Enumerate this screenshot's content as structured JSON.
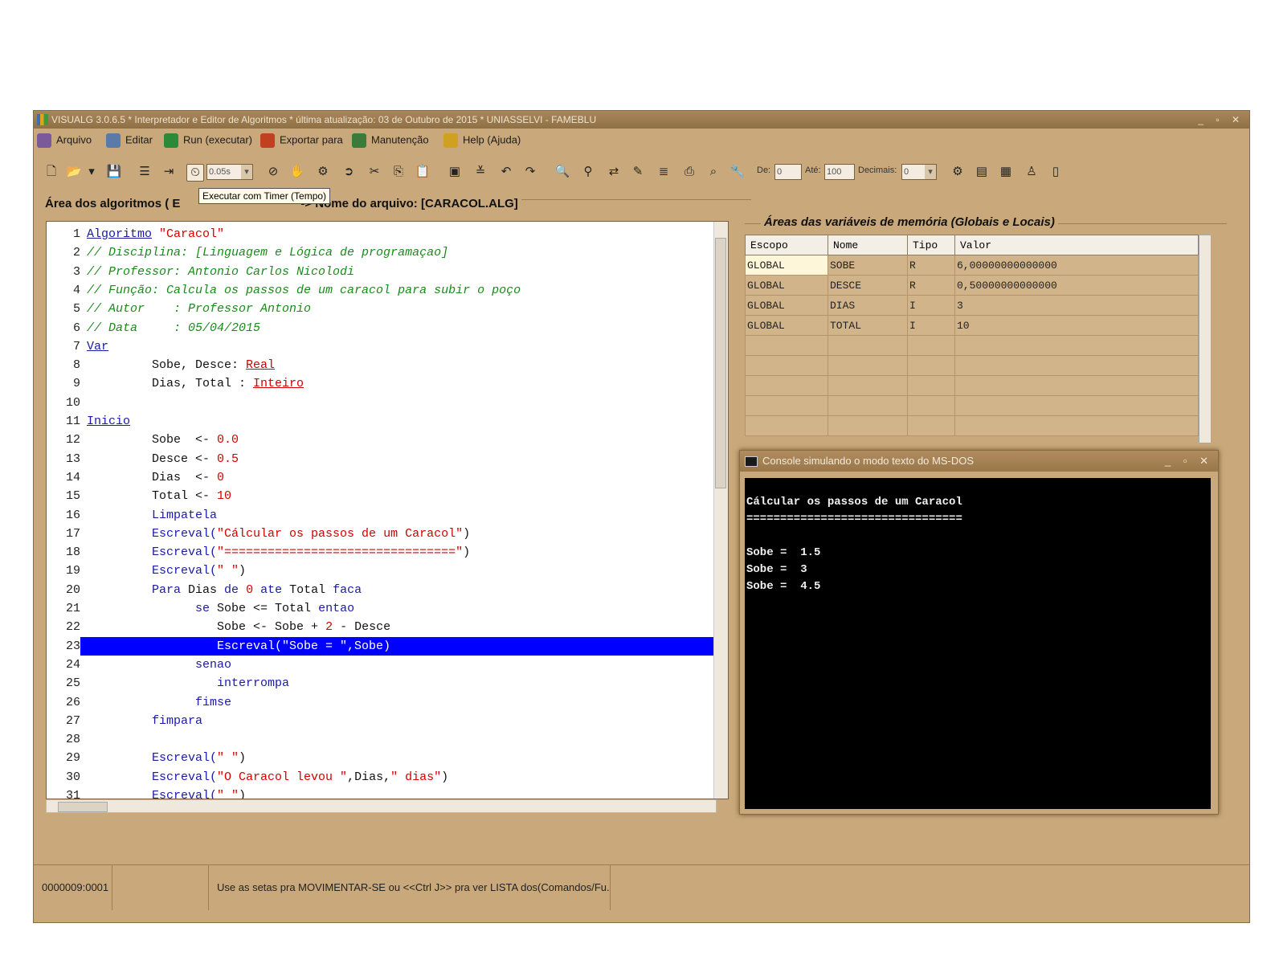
{
  "window": {
    "title": "VISUALG 3.0.6.5 * Interpretador e Editor de Algoritmos * última atualização: 03 de Outubro de 2015 * UNIASSELVI - FAMEBLU"
  },
  "menu": [
    {
      "label": "Arquivo",
      "icon": "printer-icon"
    },
    {
      "label": "Editar",
      "icon": "edit-icon"
    },
    {
      "label": "Run (executar)",
      "icon": "runner-icon"
    },
    {
      "label": "Exportar para",
      "icon": "export-icon"
    },
    {
      "label": "Manutenção",
      "icon": "maintenance-icon"
    },
    {
      "label": "Help (Ajuda)",
      "icon": "help-icon"
    }
  ],
  "toolbar": {
    "timer_value": "0.05s",
    "de_label": "De:",
    "de_value": "0",
    "ate_label": "Até:",
    "ate_value": "100",
    "decimais_label": "Decimais:",
    "decimais_value": "0",
    "tooltip": "Executar com Timer (Tempo)"
  },
  "algo_area": {
    "title_prefix": "Área dos algoritmos ( E",
    "title_suffix": "-> Nome do arquivo: [CARACOL.ALG]"
  },
  "code": [
    [
      {
        "t": "Algoritmo",
        "c": "#1a1aa6",
        "u": true
      },
      {
        "t": " \"Caracol\"",
        "c": "#d40000"
      }
    ],
    [
      {
        "t": "// Disciplina: [Linguagem e Lógica de programaçao]",
        "c": "#1a8a1a",
        "i": true
      }
    ],
    [
      {
        "t": "// Professor: Antonio Carlos Nicolodi",
        "c": "#1a8a1a",
        "i": true
      }
    ],
    [
      {
        "t": "// Função: Calcula os passos de um caracol para subir o poço",
        "c": "#1a8a1a",
        "i": true
      }
    ],
    [
      {
        "t": "// Autor    : Professor Antonio",
        "c": "#1a8a1a",
        "i": true
      }
    ],
    [
      {
        "t": "// Data     : 05/04/2015",
        "c": "#1a8a1a",
        "i": true
      }
    ],
    [
      {
        "t": "Var",
        "c": "#1a1aa6",
        "u": true
      }
    ],
    [
      {
        "t": "         Sobe, Desce: ",
        "c": "#111"
      },
      {
        "t": "Real",
        "c": "#d40000",
        "u": true
      }
    ],
    [
      {
        "t": "         Dias, Total : ",
        "c": "#111"
      },
      {
        "t": "Inteiro",
        "c": "#d40000",
        "u": true
      }
    ],
    [],
    [
      {
        "t": "Inicio",
        "c": "#1a1aa6",
        "u": true
      }
    ],
    [
      {
        "t": "         Sobe  <- ",
        "c": "#111"
      },
      {
        "t": "0.0",
        "c": "#d40000"
      }
    ],
    [
      {
        "t": "         Desce <- ",
        "c": "#111"
      },
      {
        "t": "0.5",
        "c": "#d40000"
      }
    ],
    [
      {
        "t": "         Dias  <- ",
        "c": "#111"
      },
      {
        "t": "0",
        "c": "#d40000"
      }
    ],
    [
      {
        "t": "         Total <- ",
        "c": "#111"
      },
      {
        "t": "10",
        "c": "#d40000"
      }
    ],
    [
      {
        "t": "         Limpatela",
        "c": "#1a1aa6"
      }
    ],
    [
      {
        "t": "         Escreval(",
        "c": "#1a1aa6"
      },
      {
        "t": "\"Cálcular os passos de um Caracol\"",
        "c": "#d40000"
      },
      {
        "t": ")",
        "c": "#111"
      }
    ],
    [
      {
        "t": "         Escreval(",
        "c": "#1a1aa6"
      },
      {
        "t": "\"================================\"",
        "c": "#d40000"
      },
      {
        "t": ")",
        "c": "#111"
      }
    ],
    [
      {
        "t": "         Escreval(",
        "c": "#1a1aa6"
      },
      {
        "t": "\" \"",
        "c": "#d40000"
      },
      {
        "t": ")",
        "c": "#111"
      }
    ],
    [
      {
        "t": "         Para ",
        "c": "#1a1aa6"
      },
      {
        "t": "Dias ",
        "c": "#111"
      },
      {
        "t": "de ",
        "c": "#1a1aa6"
      },
      {
        "t": "0 ",
        "c": "#d40000"
      },
      {
        "t": "ate ",
        "c": "#1a1aa6"
      },
      {
        "t": "Total ",
        "c": "#111"
      },
      {
        "t": "faca",
        "c": "#1a1aa6"
      }
    ],
    [
      {
        "t": "               se ",
        "c": "#1a1aa6"
      },
      {
        "t": "Sobe <= Total ",
        "c": "#111"
      },
      {
        "t": "entao",
        "c": "#1a1aa6"
      }
    ],
    [
      {
        "t": "                  Sobe <- Sobe + ",
        "c": "#111"
      },
      {
        "t": "2",
        "c": "#d40000"
      },
      {
        "t": " - Desce",
        "c": "#111"
      }
    ],
    [
      {
        "t": "                  Escreval(\"Sobe = \",Sobe)",
        "c": "#ffffff"
      }
    ],
    [
      {
        "t": "               senao",
        "c": "#1a1aa6"
      }
    ],
    [
      {
        "t": "                  interrompa",
        "c": "#1a1aa6"
      }
    ],
    [
      {
        "t": "               fimse",
        "c": "#1a1aa6"
      }
    ],
    [
      {
        "t": "         fimpara",
        "c": "#1a1aa6"
      }
    ],
    [],
    [
      {
        "t": "         Escreval(",
        "c": "#1a1aa6"
      },
      {
        "t": "\" \"",
        "c": "#d40000"
      },
      {
        "t": ")",
        "c": "#111"
      }
    ],
    [
      {
        "t": "         Escreval(",
        "c": "#1a1aa6"
      },
      {
        "t": "\"O Caracol levou \"",
        "c": "#d40000"
      },
      {
        "t": ",Dias,",
        "c": "#111"
      },
      {
        "t": "\" dias\"",
        "c": "#d40000"
      },
      {
        "t": ")",
        "c": "#111"
      }
    ],
    [
      {
        "t": "         Escreval(",
        "c": "#1a1aa6"
      },
      {
        "t": "\" \"",
        "c": "#d40000"
      },
      {
        "t": ")",
        "c": "#111"
      }
    ]
  ],
  "highlight_line": 23,
  "memory": {
    "title": "Áreas das variáveis de memória (Globais e Locais)",
    "headers": [
      "Escopo",
      "Nome",
      "Tipo",
      "Valor"
    ],
    "rows": [
      [
        "GLOBAL",
        "SOBE",
        "R",
        "6,00000000000000"
      ],
      [
        "GLOBAL",
        "DESCE",
        "R",
        "0,50000000000000"
      ],
      [
        "GLOBAL",
        "DIAS",
        "I",
        "3"
      ],
      [
        "GLOBAL",
        "TOTAL",
        "I",
        "10"
      ],
      [
        "",
        "",
        "",
        ""
      ],
      [
        "",
        "",
        "",
        ""
      ],
      [
        "",
        "",
        "",
        ""
      ],
      [
        "",
        "",
        "",
        ""
      ],
      [
        "",
        "",
        "",
        ""
      ]
    ]
  },
  "console": {
    "title": "Console simulando o modo texto do MS-DOS",
    "lines": [
      "Cálcular os passos de um Caracol",
      "================================",
      "",
      "Sobe =  1.5",
      "Sobe =  3",
      "Sobe =  4.5"
    ]
  },
  "status": {
    "position": "0000009:0001",
    "empty": "",
    "hint": "Use as setas pra MOVIMENTAR-SE ou <<Ctrl J>> pra ver LISTA dos(Comandos/Fu..."
  }
}
